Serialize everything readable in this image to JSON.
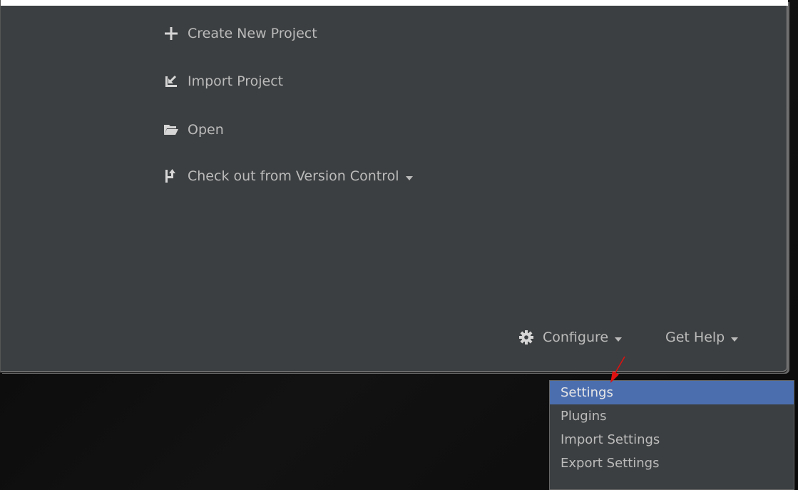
{
  "welcome": {
    "actions": [
      {
        "label": "Create New Project",
        "icon": "plus-icon"
      },
      {
        "label": "Import Project",
        "icon": "import-project-icon"
      },
      {
        "label": "Open",
        "icon": "folder-open-icon"
      },
      {
        "label": "Check out from Version Control",
        "icon": "vcs-checkout-icon"
      }
    ],
    "footer": {
      "configure_label": "Configure",
      "get_help_label": "Get Help"
    }
  },
  "configure_menu": {
    "items": [
      {
        "label": "Settings",
        "selected": true
      },
      {
        "label": "Plugins",
        "selected": false
      },
      {
        "label": "Import Settings",
        "selected": false
      },
      {
        "label": "Export Settings",
        "selected": false
      }
    ]
  },
  "colors": {
    "panel_bg": "#3c3f41",
    "text": "#bbbbbb",
    "selection": "#4b6eaf",
    "annotation_arrow": "#ff0000"
  }
}
